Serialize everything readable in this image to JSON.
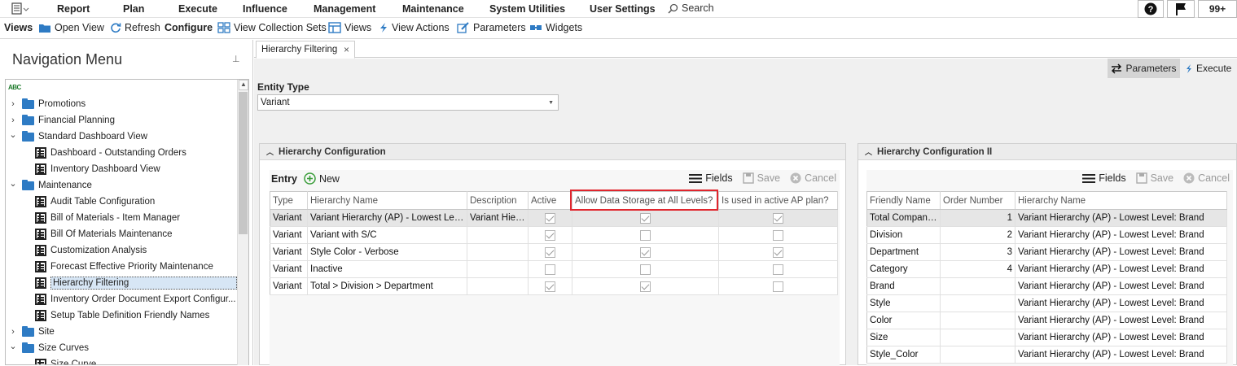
{
  "menubar": {
    "items": [
      "Report",
      "Plan",
      "Execute",
      "Influence",
      "Management",
      "Maintenance",
      "System Utilities",
      "User Settings"
    ],
    "search": "Search",
    "badge": "99+"
  },
  "toolbar": {
    "views": "Views",
    "open_view": "Open View",
    "refresh": "Refresh",
    "configure": "Configure",
    "view_collection_sets": "View Collection Sets",
    "views2": "Views",
    "view_actions": "View Actions",
    "parameters": "Parameters",
    "widgets": "Widgets"
  },
  "nav": {
    "title": "Navigation Menu",
    "filter_icon": "abc-filter-icon",
    "items": [
      {
        "label": "Promotions",
        "type": "folder",
        "expanded": false
      },
      {
        "label": "Financial Planning",
        "type": "folder",
        "expanded": false
      },
      {
        "label": "Standard Dashboard View",
        "type": "folder",
        "expanded": true
      },
      {
        "label": "Dashboard - Outstanding Orders",
        "type": "view"
      },
      {
        "label": "Inventory Dashboard View",
        "type": "view"
      },
      {
        "label": "Maintenance",
        "type": "folder",
        "expanded": true
      },
      {
        "label": "Audit Table Configuration",
        "type": "view"
      },
      {
        "label": "Bill of Materials - Item Manager",
        "type": "view"
      },
      {
        "label": "Bill Of Materials Maintenance",
        "type": "view"
      },
      {
        "label": "Customization Analysis",
        "type": "view"
      },
      {
        "label": "Forecast Effective Priority Maintenance",
        "type": "view"
      },
      {
        "label": "Hierarchy Filtering",
        "type": "view",
        "selected": true
      },
      {
        "label": "Inventory Order Document Export Configur...",
        "type": "view"
      },
      {
        "label": "Setup Table Definition Friendly Names",
        "type": "view"
      },
      {
        "label": "Site",
        "type": "folder",
        "expanded": false
      },
      {
        "label": "Size Curves",
        "type": "folder",
        "expanded": true
      },
      {
        "label": "Size Curve",
        "type": "view"
      }
    ]
  },
  "tab": {
    "label": "Hierarchy Filtering"
  },
  "actions": {
    "parameters": "Parameters",
    "execute": "Execute"
  },
  "entity": {
    "label": "Entity Type",
    "value": "Variant"
  },
  "config1": {
    "title": "Hierarchy Configuration",
    "entry": "Entry",
    "new": "New",
    "fields": "Fields",
    "save": "Save",
    "cancel": "Cancel",
    "columns": [
      "Type",
      "Hierarchy Name",
      "Description",
      "Active",
      "Allow Data Storage at All Levels?",
      "Is used in active AP plan?"
    ],
    "rows": [
      {
        "type": "Variant",
        "name": "Variant Hierarchy (AP) - Lowest Level...",
        "desc": "Variant Hier...",
        "active": true,
        "allow": true,
        "used": true
      },
      {
        "type": "Variant",
        "name": "Variant with S/C",
        "desc": "",
        "active": true,
        "allow": false,
        "used": false
      },
      {
        "type": "Variant",
        "name": "Style Color - Verbose",
        "desc": "",
        "active": true,
        "allow": true,
        "used": true
      },
      {
        "type": "Variant",
        "name": "Inactive",
        "desc": "",
        "active": false,
        "allow": false,
        "used": false
      },
      {
        "type": "Variant",
        "name": "Total > Division > Department",
        "desc": "",
        "active": true,
        "allow": true,
        "used": false
      }
    ]
  },
  "config2": {
    "title": "Hierarchy Configuration II",
    "fields": "Fields",
    "save": "Save",
    "cancel": "Cancel",
    "columns": [
      "Friendly Name",
      "Order Number",
      "Hierarchy Name"
    ],
    "rows": [
      {
        "friendly": "Total Company...",
        "order": "1",
        "name": "Variant Hierarchy (AP) - Lowest Level: Brand"
      },
      {
        "friendly": "Division",
        "order": "2",
        "name": "Variant Hierarchy (AP) - Lowest Level: Brand"
      },
      {
        "friendly": "Department",
        "order": "3",
        "name": "Variant Hierarchy (AP) - Lowest Level: Brand"
      },
      {
        "friendly": "Category",
        "order": "4",
        "name": "Variant Hierarchy (AP) - Lowest Level: Brand"
      },
      {
        "friendly": "Brand",
        "order": "",
        "name": "Variant Hierarchy (AP) - Lowest Level: Brand"
      },
      {
        "friendly": "Style",
        "order": "",
        "name": "Variant Hierarchy (AP) - Lowest Level: Brand"
      },
      {
        "friendly": "Color",
        "order": "",
        "name": "Variant Hierarchy (AP) - Lowest Level: Brand"
      },
      {
        "friendly": "Size",
        "order": "",
        "name": "Variant Hierarchy (AP) - Lowest Level: Brand"
      },
      {
        "friendly": "Style_Color",
        "order": "",
        "name": "Variant Hierarchy (AP) - Lowest Level: Brand"
      }
    ]
  },
  "colors": {
    "accent": "#2e7bc4",
    "highlight": "#e0262e",
    "selected": "#d7e6f5",
    "new_icon": "#3a9d3a"
  }
}
